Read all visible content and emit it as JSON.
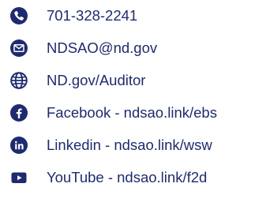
{
  "colors": {
    "icon": "#1e2b6e",
    "text": "#1e2b6e",
    "background": "#ffffff"
  },
  "contacts": [
    {
      "icon": "phone-icon",
      "label": "701-328-2241"
    },
    {
      "icon": "email-icon",
      "label": "NDSAO@nd.gov"
    },
    {
      "icon": "globe-icon",
      "label": "ND.gov/Auditor"
    },
    {
      "icon": "facebook-icon",
      "label": "Facebook - ndsao.link/ebs"
    },
    {
      "icon": "linkedin-icon",
      "label": "Linkedin - ndsao.link/wsw"
    },
    {
      "icon": "youtube-icon",
      "label": "YouTube - ndsao.link/f2d"
    }
  ]
}
